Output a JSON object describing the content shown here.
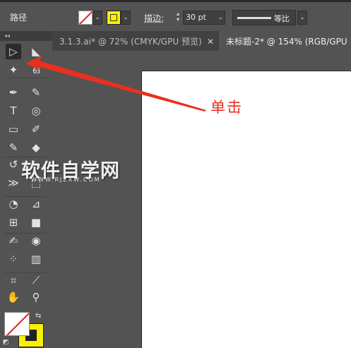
{
  "control_bar": {
    "object_label": "路径",
    "stroke_label": "描边",
    "stroke_colon": ":",
    "stroke_weight": "30 pt",
    "profile_label": "等比",
    "stroke_color": "#e02020",
    "fill_color": "#f6f200"
  },
  "toolbox": {
    "collapse_glyph": "◂◂",
    "tools": [
      {
        "name": "selection-tool-icon",
        "glyph": "▷"
      },
      {
        "name": "direct-selection-tool-icon",
        "glyph": "◣"
      },
      {
        "name": "magic-wand-tool-icon",
        "glyph": "✦"
      },
      {
        "name": "lasso-tool-icon",
        "glyph": "ഒ"
      },
      {
        "name": "pen-tool-icon",
        "glyph": "✒"
      },
      {
        "name": "curvature-tool-icon",
        "glyph": "✎"
      },
      {
        "name": "type-tool-icon",
        "glyph": "T"
      },
      {
        "name": "spiral-tool-icon",
        "glyph": "◎"
      },
      {
        "name": "rectangle-tool-icon",
        "glyph": "▭"
      },
      {
        "name": "paintbrush-tool-icon",
        "glyph": "✐"
      },
      {
        "name": "shaper-tool-icon",
        "glyph": "✎"
      },
      {
        "name": "eraser-tool-icon",
        "glyph": "◆"
      },
      {
        "name": "rotate-tool-icon",
        "glyph": "↺"
      },
      {
        "name": "scale-tool-icon",
        "glyph": "⤡"
      },
      {
        "name": "width-tool-icon",
        "glyph": "≫"
      },
      {
        "name": "free-transform-tool-icon",
        "glyph": "⬚"
      },
      {
        "name": "shape-builder-tool-icon",
        "glyph": "◔"
      },
      {
        "name": "perspective-grid-tool-icon",
        "glyph": "⊿"
      },
      {
        "name": "mesh-tool-icon",
        "glyph": "⊞"
      },
      {
        "name": "gradient-tool-icon",
        "glyph": "■"
      },
      {
        "name": "eyedropper-tool-icon",
        "glyph": "✍"
      },
      {
        "name": "blend-tool-icon",
        "glyph": "◉"
      },
      {
        "name": "symbol-sprayer-tool-icon",
        "glyph": "⁘"
      },
      {
        "name": "column-graph-tool-icon",
        "glyph": "▥"
      },
      {
        "name": "artboard-tool-icon",
        "glyph": "⌗"
      },
      {
        "name": "slice-tool-icon",
        "glyph": "⟋"
      },
      {
        "name": "hand-tool-icon",
        "glyph": "✋"
      },
      {
        "name": "zoom-tool-icon",
        "glyph": "⚲"
      }
    ],
    "swap_glyph": "⇆",
    "default_glyph": "◩"
  },
  "tabs": [
    {
      "label": "3.1.3.ai* @ 72% (CMYK/GPU 预览)",
      "close": "✕"
    },
    {
      "label": "未标题-2* @ 154% (RGB/GPU"
    }
  ],
  "annotation": {
    "text": "单击",
    "color": "#e83020"
  },
  "watermark": {
    "title": "软件自学网",
    "url": "WWW.RJZXW.COM"
  }
}
